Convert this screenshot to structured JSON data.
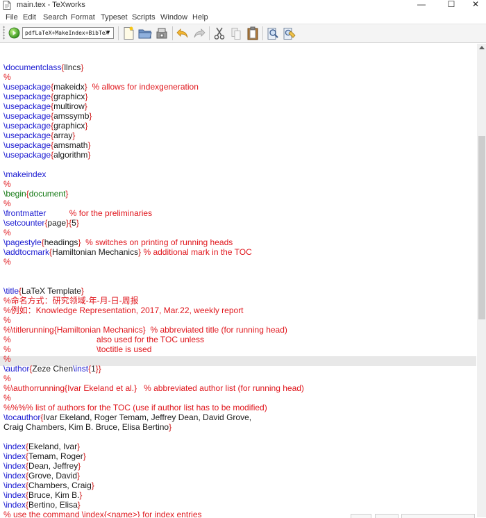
{
  "window": {
    "title": "main.tex - TeXworks",
    "minimize_glyph": "—",
    "maximize_glyph": "☐",
    "close_glyph": "✕"
  },
  "menu": [
    {
      "label": "File"
    },
    {
      "label": "Edit"
    },
    {
      "label": "Search"
    },
    {
      "label": "Format"
    },
    {
      "label": "Typeset"
    },
    {
      "label": "Scripts"
    },
    {
      "label": "Window"
    },
    {
      "label": "Help"
    }
  ],
  "toolbar": {
    "typeset_engine": "pdfLaTeX+MakeIndex+BibTeX",
    "buttons": [
      {
        "name": "typeset-button",
        "icon": "green-play-icon"
      },
      {
        "name": "new-button",
        "icon": "new-file-icon"
      },
      {
        "name": "open-button",
        "icon": "folder-icon"
      },
      {
        "name": "save-button",
        "icon": "save-icon"
      },
      {
        "name": "undo-button",
        "icon": "undo-icon"
      },
      {
        "name": "redo-button",
        "icon": "redo-icon"
      },
      {
        "name": "cut-button",
        "icon": "scissors-icon"
      },
      {
        "name": "copy-button",
        "icon": "copy-icon"
      },
      {
        "name": "paste-button",
        "icon": "clipboard-icon"
      },
      {
        "name": "find-button",
        "icon": "magnifier-icon"
      },
      {
        "name": "replace-button",
        "icon": "find-replace-icon"
      }
    ]
  },
  "colors": {
    "command": "#1a1ad1",
    "brace": "#d01919",
    "environment": "#127812",
    "comment": "#e0161c",
    "current_line_highlight": "#e8e8e8"
  },
  "editor": {
    "current_line": 31,
    "lines": [
      [],
      [
        {
          "t": "\\documentclass",
          "c": "cmd"
        },
        {
          "t": "{",
          "c": "brace"
        },
        {
          "t": "llncs",
          "c": "arg"
        },
        {
          "t": "}",
          "c": "brace"
        }
      ],
      [
        {
          "t": "%",
          "c": "cmt"
        }
      ],
      [
        {
          "t": "\\usepackage",
          "c": "cmd"
        },
        {
          "t": "{",
          "c": "brace"
        },
        {
          "t": "makeidx",
          "c": "arg"
        },
        {
          "t": "}",
          "c": "brace"
        },
        {
          "t": "  % allows for indexgeneration",
          "c": "cmt"
        }
      ],
      [
        {
          "t": "\\usepackage",
          "c": "cmd"
        },
        {
          "t": "{",
          "c": "brace"
        },
        {
          "t": "graphicx",
          "c": "arg"
        },
        {
          "t": "}",
          "c": "brace"
        }
      ],
      [
        {
          "t": "\\usepackage",
          "c": "cmd"
        },
        {
          "t": "{",
          "c": "brace"
        },
        {
          "t": "multirow",
          "c": "arg"
        },
        {
          "t": "}",
          "c": "brace"
        }
      ],
      [
        {
          "t": "\\usepackage",
          "c": "cmd"
        },
        {
          "t": "{",
          "c": "brace"
        },
        {
          "t": "amssymb",
          "c": "arg"
        },
        {
          "t": "}",
          "c": "brace"
        }
      ],
      [
        {
          "t": "\\usepackage",
          "c": "cmd"
        },
        {
          "t": "{",
          "c": "brace"
        },
        {
          "t": "graphicx",
          "c": "arg"
        },
        {
          "t": "}",
          "c": "brace"
        }
      ],
      [
        {
          "t": "\\usepackage",
          "c": "cmd"
        },
        {
          "t": "{",
          "c": "brace"
        },
        {
          "t": "array",
          "c": "arg"
        },
        {
          "t": "}",
          "c": "brace"
        }
      ],
      [
        {
          "t": "\\usepackage",
          "c": "cmd"
        },
        {
          "t": "{",
          "c": "brace"
        },
        {
          "t": "amsmath",
          "c": "arg"
        },
        {
          "t": "}",
          "c": "brace"
        }
      ],
      [
        {
          "t": "\\usepackage",
          "c": "cmd"
        },
        {
          "t": "{",
          "c": "brace"
        },
        {
          "t": "algorithm",
          "c": "arg"
        },
        {
          "t": "}",
          "c": "brace"
        }
      ],
      [],
      [
        {
          "t": "\\makeindex",
          "c": "cmd"
        }
      ],
      [
        {
          "t": "%",
          "c": "cmt"
        }
      ],
      [
        {
          "t": "\\begin",
          "c": "env"
        },
        {
          "t": "{",
          "c": "brace"
        },
        {
          "t": "document",
          "c": "env"
        },
        {
          "t": "}",
          "c": "brace"
        }
      ],
      [
        {
          "t": "%",
          "c": "cmt"
        }
      ],
      [
        {
          "t": "\\frontmatter",
          "c": "cmd"
        },
        {
          "t": "          % for the preliminaries",
          "c": "cmt"
        }
      ],
      [
        {
          "t": "\\setcounter",
          "c": "cmd"
        },
        {
          "t": "{",
          "c": "brace"
        },
        {
          "t": "page",
          "c": "arg"
        },
        {
          "t": "}",
          "c": "brace"
        },
        {
          "t": "{",
          "c": "brace"
        },
        {
          "t": "5",
          "c": "arg"
        },
        {
          "t": "}",
          "c": "brace"
        }
      ],
      [
        {
          "t": "%",
          "c": "cmt"
        }
      ],
      [
        {
          "t": "\\pagestyle",
          "c": "cmd"
        },
        {
          "t": "{",
          "c": "brace"
        },
        {
          "t": "headings",
          "c": "arg"
        },
        {
          "t": "}",
          "c": "brace"
        },
        {
          "t": "  % switches on printing of running heads",
          "c": "cmt"
        }
      ],
      [
        {
          "t": "\\addtocmark",
          "c": "cmd"
        },
        {
          "t": "{",
          "c": "brace"
        },
        {
          "t": "Hamiltonian Mechanics",
          "c": "arg"
        },
        {
          "t": "}",
          "c": "brace"
        },
        {
          "t": " % additional mark in the TOC",
          "c": "cmt"
        }
      ],
      [
        {
          "t": "%",
          "c": "cmt"
        }
      ],
      [],
      [],
      [
        {
          "t": "\\title",
          "c": "cmd"
        },
        {
          "t": "{",
          "c": "brace"
        },
        {
          "t": "LaTeX Template",
          "c": "arg"
        },
        {
          "t": "}",
          "c": "brace"
        }
      ],
      [
        {
          "t": "%命名方式：研究领域-年-月-日-周报",
          "c": "cmt"
        }
      ],
      [
        {
          "t": "%例如：Knowledge Representation, 2017, Mar.22, weekly report",
          "c": "cmt"
        }
      ],
      [
        {
          "t": "%",
          "c": "cmt"
        }
      ],
      [
        {
          "t": "%\\titlerunning{Hamiltonian Mechanics}  % abbreviated title (for running head)",
          "c": "cmt"
        }
      ],
      [
        {
          "t": "%                                     also used for the TOC unless",
          "c": "cmt"
        }
      ],
      [
        {
          "t": "%                                     \\toctitle is used",
          "c": "cmt"
        }
      ],
      [
        {
          "t": "%",
          "c": "cmt"
        }
      ],
      [
        {
          "t": "\\author",
          "c": "cmd"
        },
        {
          "t": "{",
          "c": "brace"
        },
        {
          "t": "Zeze Chen",
          "c": "arg"
        },
        {
          "t": "\\inst",
          "c": "cmd"
        },
        {
          "t": "{",
          "c": "brace"
        },
        {
          "t": "1",
          "c": "arg"
        },
        {
          "t": "}}",
          "c": "brace"
        }
      ],
      [
        {
          "t": "%",
          "c": "cmt"
        }
      ],
      [
        {
          "t": "%\\authorrunning{Ivar Ekeland et al.}   % abbreviated author list (for running head)",
          "c": "cmt"
        }
      ],
      [
        {
          "t": "%",
          "c": "cmt"
        }
      ],
      [
        {
          "t": "%%%% list of authors for the TOC (use if author list has to be modified)",
          "c": "cmt"
        }
      ],
      [
        {
          "t": "\\tocauthor",
          "c": "cmd"
        },
        {
          "t": "{",
          "c": "brace"
        },
        {
          "t": "Ivar Ekeland, Roger Temam, Jeffrey Dean, David Grove,",
          "c": "arg"
        }
      ],
      [
        {
          "t": "Craig Chambers, Kim B. Bruce, Elisa Bertino",
          "c": "arg"
        },
        {
          "t": "}",
          "c": "brace"
        }
      ],
      [],
      [
        {
          "t": "\\index",
          "c": "cmd"
        },
        {
          "t": "{",
          "c": "brace"
        },
        {
          "t": "Ekeland, Ivar",
          "c": "arg"
        },
        {
          "t": "}",
          "c": "brace"
        }
      ],
      [
        {
          "t": "\\index",
          "c": "cmd"
        },
        {
          "t": "{",
          "c": "brace"
        },
        {
          "t": "Temam, Roger",
          "c": "arg"
        },
        {
          "t": "}",
          "c": "brace"
        }
      ],
      [
        {
          "t": "\\index",
          "c": "cmd"
        },
        {
          "t": "{",
          "c": "brace"
        },
        {
          "t": "Dean, Jeffrey",
          "c": "arg"
        },
        {
          "t": "}",
          "c": "brace"
        }
      ],
      [
        {
          "t": "\\index",
          "c": "cmd"
        },
        {
          "t": "{",
          "c": "brace"
        },
        {
          "t": "Grove, David",
          "c": "arg"
        },
        {
          "t": "}",
          "c": "brace"
        }
      ],
      [
        {
          "t": "\\index",
          "c": "cmd"
        },
        {
          "t": "{",
          "c": "brace"
        },
        {
          "t": "Chambers, Craig",
          "c": "arg"
        },
        {
          "t": "}",
          "c": "brace"
        }
      ],
      [
        {
          "t": "\\index",
          "c": "cmd"
        },
        {
          "t": "{",
          "c": "brace"
        },
        {
          "t": "Bruce, Kim B.",
          "c": "arg"
        },
        {
          "t": "}",
          "c": "brace"
        }
      ],
      [
        {
          "t": "\\index",
          "c": "cmd"
        },
        {
          "t": "{",
          "c": "brace"
        },
        {
          "t": "Bertino, Elisa",
          "c": "arg"
        },
        {
          "t": "}",
          "c": "brace"
        }
      ],
      [
        {
          "t": "% use the command \\index{<name>} for index entries",
          "c": "cmt"
        }
      ]
    ]
  }
}
